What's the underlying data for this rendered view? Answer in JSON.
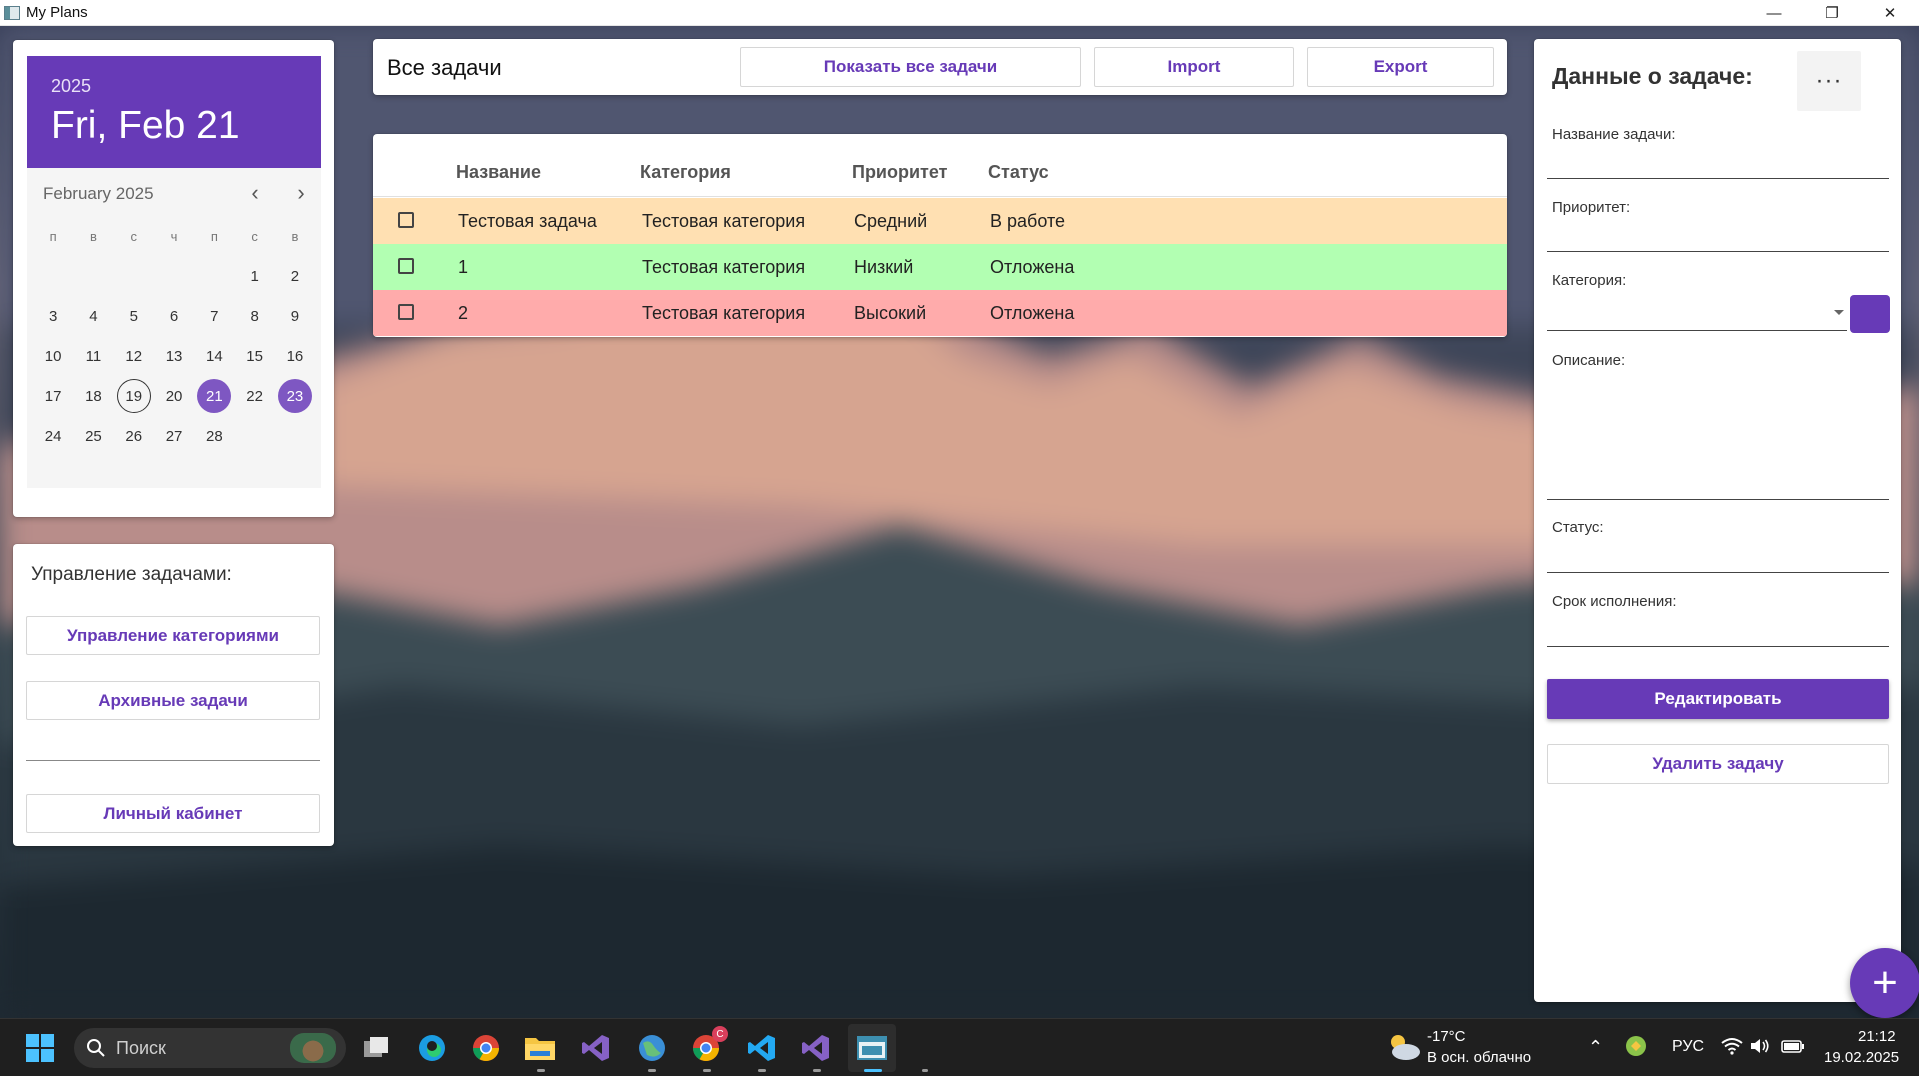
{
  "window": {
    "title": "My Plans",
    "minimize": "—",
    "maximize": "❐",
    "close": "✕"
  },
  "calendar": {
    "year": "2025",
    "date": "Fri, Feb 21",
    "month_label": "February 2025",
    "prev": "‹",
    "next": "›",
    "weekdays": [
      "п",
      "в",
      "с",
      "ч",
      "п",
      "с",
      "в"
    ],
    "weeks": [
      [
        "",
        "",
        "",
        "",
        "1",
        "2"
      ],
      [
        "3",
        "4",
        "5",
        "6",
        "7",
        "8",
        "9"
      ],
      [
        "10",
        "11",
        "12",
        "13",
        "14",
        "15",
        "16"
      ],
      [
        "17",
        "18",
        "19",
        "20",
        "21",
        "22",
        "23"
      ],
      [
        "24",
        "25",
        "26",
        "27",
        "28"
      ]
    ],
    "today": "19",
    "selected": [
      "21",
      "23"
    ]
  },
  "manage": {
    "title": "Управление задачами:",
    "categories_btn": "Управление категориями",
    "archive_btn": "Архивные задачи",
    "profile_btn": "Личный кабинет"
  },
  "toolbar": {
    "title": "Все задачи",
    "show_all_btn": "Показать все задачи",
    "import_btn": "Import",
    "export_btn": "Export"
  },
  "tasks": {
    "columns": [
      "Название",
      "Категория",
      "Приоритет",
      "Статус"
    ],
    "rows": [
      {
        "name": "Тестовая задача",
        "category": "Тестовая категория",
        "priority": "Средний",
        "status": "В работе",
        "color": "#ffe0b2"
      },
      {
        "name": "1",
        "category": "Тестовая категория",
        "priority": "Низкий",
        "status": "Отложена",
        "color": "#b2ffb2"
      },
      {
        "name": "2",
        "category": "Тестовая категория",
        "priority": "Высокий",
        "status": "Отложена",
        "color": "#ffabab"
      }
    ]
  },
  "details": {
    "title": "Данные о задаче:",
    "more": "···",
    "name_label": "Название задачи:",
    "priority_label": "Приоритет:",
    "category_label": "Категория:",
    "description_label": "Описание:",
    "status_label": "Статус:",
    "due_label": "Срок исполнения:",
    "edit_btn": "Редактировать",
    "delete_btn": "Удалить задачу",
    "category_color": "#673ab7"
  },
  "fab": {
    "label": "+"
  },
  "taskbar": {
    "search_placeholder": "Поиск",
    "weather_temp": "-17°C",
    "weather_desc": "В осн. облачно",
    "language": "РУС",
    "time": "21:12",
    "date": "19.02.2025",
    "chrome_badge": "C"
  },
  "accent_color": "#673ab7"
}
